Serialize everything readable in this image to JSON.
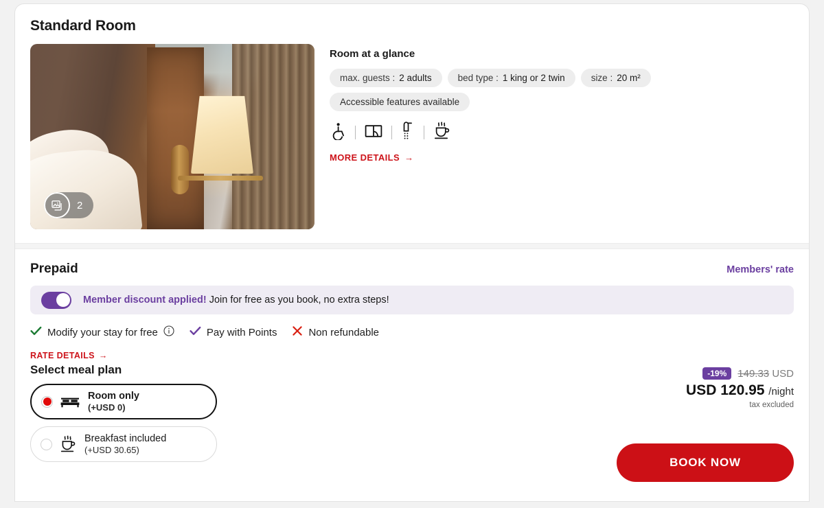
{
  "room": {
    "title": "Standard Room",
    "photo_badge": {
      "icon": "photo-stack-icon",
      "count": "2"
    },
    "glance": {
      "title": "Room at a glance",
      "chips": [
        {
          "key": "max. guests :",
          "value": "2 adults"
        },
        {
          "key": "bed type :",
          "value": "1 king or 2 twin"
        },
        {
          "key": "size :",
          "value": "20 m²"
        }
      ],
      "accessible_chip": "Accessible features available",
      "amenities": [
        "wheelchair-accessible-icon",
        "room-layout-icon",
        "shower-icon",
        "coffee-icon"
      ],
      "more_details": "MORE DETAILS",
      "more_details_arrow": "→"
    }
  },
  "rate": {
    "title": "Prepaid",
    "members_rate": "Members' rate",
    "banner": {
      "highlight": "Member discount applied!",
      "text": " Join for free as you book, no extra steps!",
      "toggle_state": "on"
    },
    "benefits": [
      {
        "mark": "check",
        "label": "Modify your stay for free",
        "info": true
      },
      {
        "mark": "check-purple",
        "label": "Pay with Points",
        "info": false
      },
      {
        "mark": "cross",
        "label": "Non refundable",
        "info": false
      }
    ],
    "rate_details": "RATE DETAILS",
    "rate_details_arrow": "→",
    "meal_title": "Select meal plan",
    "meal_options": [
      {
        "name": "Room only",
        "price": "(+USD 0)",
        "icon": "bed-icon",
        "selected": true
      },
      {
        "name": "Breakfast included",
        "price": "(+USD 30.65)",
        "icon": "coffee-icon",
        "selected": false
      }
    ],
    "price": {
      "discount_badge": "-19%",
      "old_amount": "149.33",
      "old_currency": "USD",
      "new_amount": "USD 120.95",
      "per": "/night",
      "tax_note": "tax excluded"
    },
    "book_label": "BOOK NOW"
  },
  "colors": {
    "brand_red": "#cc1016",
    "member_purple": "#6b3fa0",
    "check_green": "#1a7a32",
    "cross_red": "#d91f11",
    "chip_bg": "#ededed",
    "banner_bg": "#efecf4"
  }
}
